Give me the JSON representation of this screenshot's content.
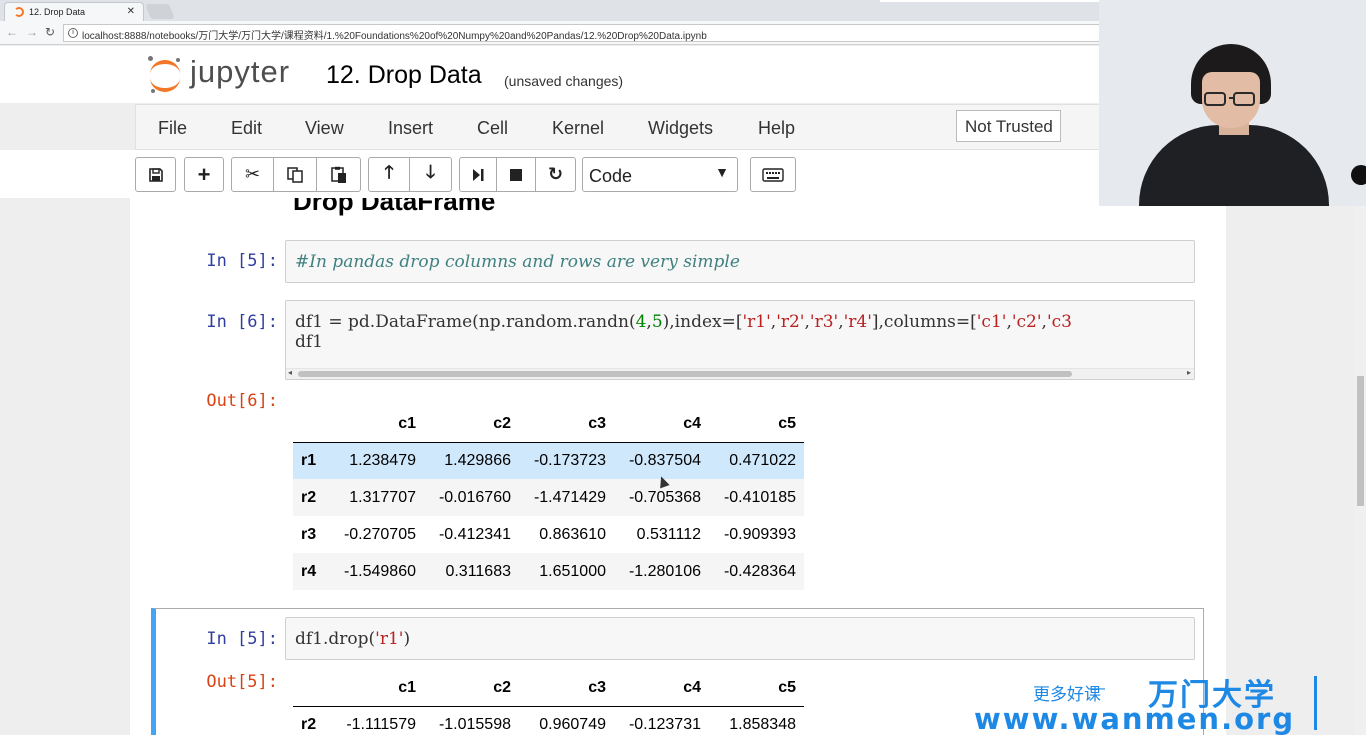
{
  "browser": {
    "tab_title": "12. Drop Data",
    "url": "localhost:8888/notebooks/万门大学/万门大学/课程资料/1.%20Foundations%20of%20Numpy%20and%20Pandas/12.%20Drop%20Data.ipynb"
  },
  "jupyter": {
    "brand": "jupyter",
    "notebook_title": "12. Drop Data",
    "status": "(unsaved changes)",
    "trusted": "Not Trusted"
  },
  "menu": [
    "File",
    "Edit",
    "View",
    "Insert",
    "Cell",
    "Kernel",
    "Widgets",
    "Help"
  ],
  "toolbar": {
    "cell_type": "Code",
    "icons": [
      "save-icon",
      "plus-icon",
      "cut-icon",
      "copy-icon",
      "paste-icon",
      "arrow-up-icon",
      "arrow-down-icon",
      "run-icon",
      "stop-icon",
      "restart-icon",
      "keyboard-icon"
    ]
  },
  "notebook": {
    "partial_heading": "Drop DataFrame",
    "cells": [
      {
        "prompt": "In  [5]:",
        "code": "#In pandas drop columns and rows are very simple"
      },
      {
        "prompt": "In  [6]:",
        "code_line1_a": "df1 = pd.DataFrame(np.random.randn(",
        "code_line1_n1": "4",
        "code_line1_b": ",",
        "code_line1_n2": "5",
        "code_line1_c": "),index=[",
        "code_line1_s1": "'r1'",
        "code_line1_s2": "'r2'",
        "code_line1_s3": "'r3'",
        "code_line1_s4": "'r4'",
        "code_line1_d": "],columns=[",
        "code_line1_s5": "'c1'",
        "code_line1_s6": "'c2'",
        "code_line1_s7": "'c3",
        "code_line2": "df1",
        "out_prompt": "Out[6]:",
        "table": {
          "columns": [
            "c1",
            "c2",
            "c3",
            "c4",
            "c5"
          ],
          "rows": [
            {
              "index": "r1",
              "values": [
                "1.238479",
                "1.429866",
                "-0.173723",
                "-0.837504",
                "0.471022"
              ]
            },
            {
              "index": "r2",
              "values": [
                "1.317707",
                "-0.016760",
                "-1.471429",
                "-0.705368",
                "-0.410185"
              ]
            },
            {
              "index": "r3",
              "values": [
                "-0.270705",
                "-0.412341",
                "0.863610",
                "0.531112",
                "-0.909393"
              ]
            },
            {
              "index": "r4",
              "values": [
                "-1.549860",
                "0.311683",
                "1.651000",
                "-1.280106",
                "-0.428364"
              ]
            }
          ]
        }
      },
      {
        "prompt": "In  [5]:",
        "code_a": "df1.drop(",
        "code_s": "'r1'",
        "code_b": ")",
        "out_prompt": "Out[5]:",
        "table": {
          "columns": [
            "c1",
            "c2",
            "c3",
            "c4",
            "c5"
          ],
          "rows": [
            {
              "index": "r2",
              "values": [
                "-1.111579",
                "-1.015598",
                "0.960749",
                "-0.123731",
                "1.858348"
              ]
            }
          ]
        }
      }
    ]
  },
  "watermark": {
    "slogan": "更多好课",
    "dash": "—",
    "brand": "万门大学",
    "url": "www.wanmen.org"
  },
  "colors": {
    "prompt_in": "#303f9f",
    "prompt_out": "#d84315",
    "selected_cell": "#42a5f5",
    "jupyter_orange": "#f37726",
    "watermark": "#1e88e5"
  }
}
